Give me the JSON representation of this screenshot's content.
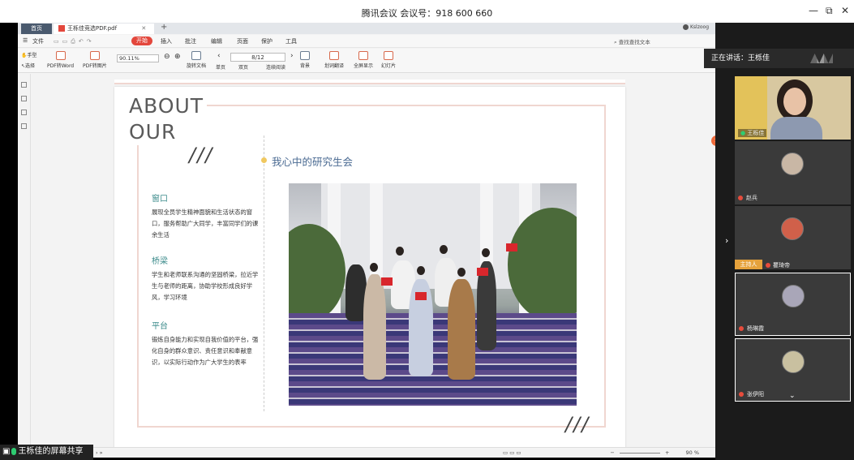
{
  "window": {
    "title": "腾讯会议 会议号：918 600 660",
    "minimize": "—",
    "restore": "⧉",
    "close": "✕"
  },
  "wps": {
    "tabs": {
      "home": "首页",
      "doc": "王栎佳竞选PDF.pdf",
      "plus": "+"
    },
    "user": "Kslzoog",
    "menu": {
      "file": "文件",
      "items": [
        "开始",
        "插入",
        "批注",
        "编辑",
        "页面",
        "保护",
        "工具"
      ],
      "search": "查找查找文本"
    },
    "toolbar": {
      "hand": "手型",
      "select": "选择",
      "pdf_word": "PDF转Word",
      "pdf_img": "PDF转图片",
      "zoom_value": "90.11%",
      "page_value": "8/12",
      "rotate": "旋转文档",
      "single": "单页",
      "double": "双页",
      "continuous": "连续阅读",
      "background": "背景",
      "translate": "划词翻译",
      "fullscreen": "全屏显示",
      "slides": "幻灯片"
    },
    "status": {
      "zoom": "90 %",
      "minus": "−",
      "plus": "+"
    }
  },
  "page": {
    "about_line1": "ABOUT",
    "about_line2": "OUR",
    "slashes_top": "///",
    "slashes_bottom": "///",
    "heading": "我心中的研究生会",
    "sections": [
      {
        "title": "窗口",
        "text": "展现全员学生精神面貌和生活状态的窗口，服务帮助广大同学，丰富同学们的课余生活"
      },
      {
        "title": "桥梁",
        "text": "学生和老师联系沟通的坚固桥梁，拉近学生与老师的距离，协助学校形成良好学风，学习环境"
      },
      {
        "title": "平台",
        "text": "锻炼自身能力和实现自我价值的平台，强化自身的群众意识、责任意识和奉献意识，以实际行动作为广大学生的表率"
      }
    ]
  },
  "share": {
    "label": "王栎佳的屏幕共享"
  },
  "panel": {
    "speaking": "正在讲话：王栎佳",
    "participants": [
      {
        "name": "王栎佳"
      },
      {
        "name": "赵兵"
      },
      {
        "name": "瞿琦帝"
      },
      {
        "name": "杨琳霞"
      },
      {
        "name": "张伊阳"
      }
    ],
    "host_badge": "主持人",
    "arrow": "›",
    "chevron": "⌄"
  }
}
